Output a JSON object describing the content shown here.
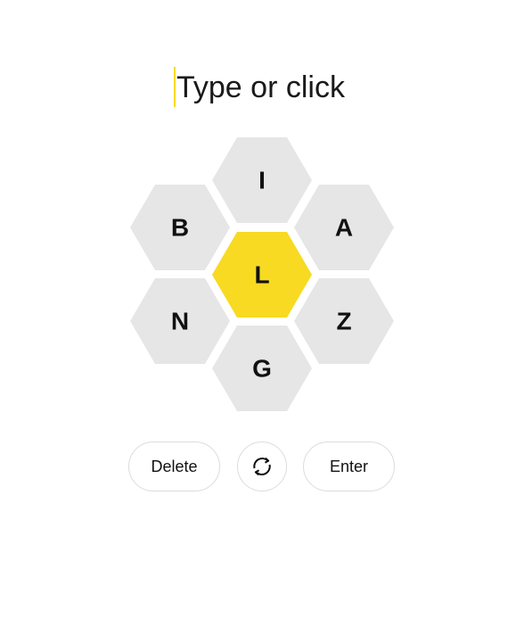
{
  "input": {
    "placeholder": "Type or click"
  },
  "hive": {
    "center_letter": "L",
    "outer_letters": [
      "I",
      "A",
      "Z",
      "G",
      "N",
      "B"
    ],
    "center_color": "#f7da21",
    "outer_color": "#e6e6e6"
  },
  "controls": {
    "delete_label": "Delete",
    "shuffle_icon": "shuffle-icon",
    "enter_label": "Enter"
  },
  "colors": {
    "caret": "#f7da21",
    "text": "#111111",
    "button_border": "#dcdcdc"
  }
}
